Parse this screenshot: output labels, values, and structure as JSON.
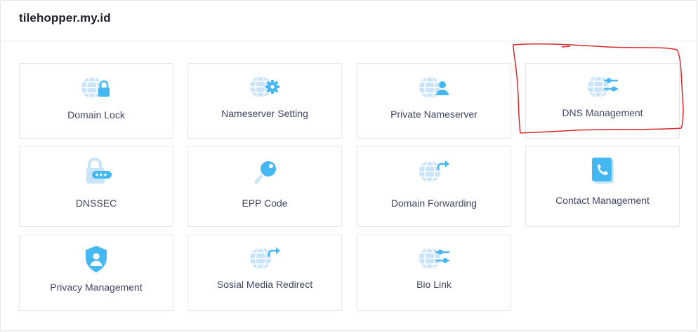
{
  "header": {
    "title": "tilehopper.my.id"
  },
  "cards": [
    {
      "label": "Domain Lock",
      "icon": "globe-lock-icon"
    },
    {
      "label": "Nameserver Setting",
      "icon": "globe-gear-icon"
    },
    {
      "label": "Private Nameserver",
      "icon": "globe-user-icon"
    },
    {
      "label": "DNS Management",
      "icon": "globe-sliders-icon"
    },
    {
      "label": "DNSSEC",
      "icon": "padlock-password-icon"
    },
    {
      "label": "EPP Code",
      "icon": "key-icon"
    },
    {
      "label": "Domain Forwarding",
      "icon": "globe-forward-icon"
    },
    {
      "label": "Contact Management",
      "icon": "phone-book-icon"
    },
    {
      "label": "Privacy Management",
      "icon": "shield-user-icon"
    },
    {
      "label": "Sosial Media Redirect",
      "icon": "globe-redirect-icon"
    },
    {
      "label": "Bio Link",
      "icon": "globe-sliders-icon"
    }
  ],
  "colors": {
    "icon_light": "#c9e3f8",
    "icon_accent": "#45b8f2",
    "annotation": "#d62b2b"
  }
}
